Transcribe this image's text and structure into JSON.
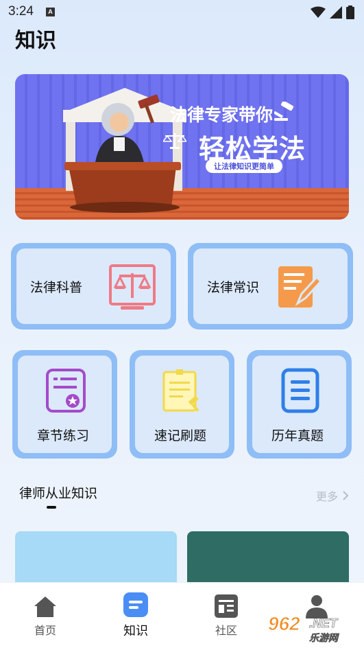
{
  "status_bar": {
    "time": "3:24",
    "notification_icon": "a-letter-icon"
  },
  "page": {
    "title": "知识"
  },
  "banner": {
    "headline_line1": "法律专家带你",
    "headline_line2": "轻松学法",
    "pill_text": "让法律知识更简单"
  },
  "top_cards": [
    {
      "label": "法律科普",
      "icon": "scales-icon"
    },
    {
      "label": "法律常识",
      "icon": "document-pen-icon"
    }
  ],
  "practice_cards": [
    {
      "label": "章节练习",
      "icon": "certificate-star-icon"
    },
    {
      "label": "速记刷题",
      "icon": "notes-gavel-icon"
    },
    {
      "label": "历年真题",
      "icon": "list-document-icon"
    }
  ],
  "section": {
    "title": "律师从业知识",
    "more_label": "更多"
  },
  "bottom_nav": [
    {
      "label": "首页",
      "icon": "home-icon",
      "active": false
    },
    {
      "label": "知识",
      "icon": "knowledge-icon",
      "active": true
    },
    {
      "label": "社区",
      "icon": "community-icon",
      "active": false
    },
    {
      "label": "",
      "icon": "profile-icon",
      "active": false
    }
  ],
  "watermark": {
    "text": "962.NET",
    "subtext": "乐游网"
  },
  "colors": {
    "accent": "#4a8ef5",
    "card_border": "#8fbdf6",
    "banner": "#6f73f0"
  }
}
